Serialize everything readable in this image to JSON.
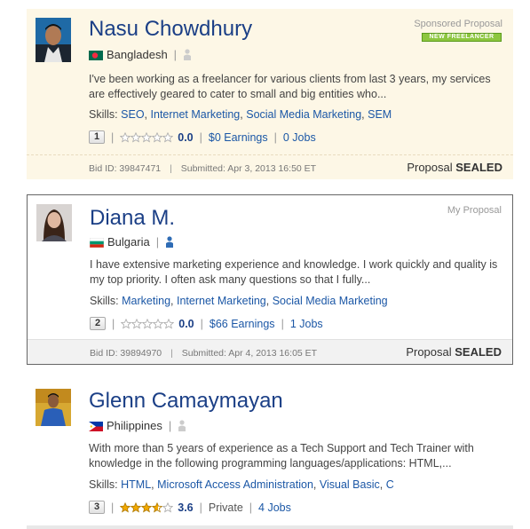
{
  "proposals": [
    {
      "name": "Nasu Chowdhury",
      "tag": "Sponsored Proposal",
      "badge": "NEW FREELANCER",
      "country": "Bangladesh",
      "description": "I've been working as a freelancer for various clients from last 3 years, my services are effectively geared to cater to small and big entities who...",
      "skills_label": "Skills:",
      "skills": [
        "SEO",
        "Internet Marketing",
        "Social Media Marketing",
        "SEM"
      ],
      "rank": "1",
      "rating": "0.0",
      "earnings": "$0 Earnings",
      "jobs": "0 Jobs",
      "bid_id": "Bid ID: 39847471",
      "submitted": "Submitted: Apr 3, 2013 16:50 ET",
      "proposal_label": "Proposal",
      "status": "SEALED"
    },
    {
      "name": "Diana M.",
      "tag": "My Proposal",
      "country": "Bulgaria",
      "description": "I have extensive marketing experience and knowledge. I work quickly and quality is my top priority. I often ask many questions so that I fully...",
      "skills_label": "Skills:",
      "skills": [
        "Marketing",
        "Internet Marketing",
        "Social Media Marketing"
      ],
      "rank": "2",
      "rating": "0.0",
      "earnings": "$66 Earnings",
      "jobs": "1 Jobs",
      "bid_id": "Bid ID: 39894970",
      "submitted": "Submitted: Apr 4, 2013 16:05 ET",
      "proposal_label": "Proposal",
      "status": "SEALED"
    },
    {
      "name": "Glenn Camaymayan",
      "country": "Philippines",
      "description": "With more than 5 years of experience as a Tech Support and Tech Trainer with knowledge in the following programming languages/applications: HTML,...",
      "skills_label": "Skills:",
      "skills": [
        "HTML",
        "Microsoft Access Administration",
        "Visual Basic",
        "C"
      ],
      "rank": "3",
      "rating": "3.6",
      "stars_filled": 3.6,
      "earnings": "Private",
      "jobs": "4 Jobs"
    }
  ],
  "separators": {
    "pipe": "|",
    "comma": ","
  },
  "colors": {
    "name": "#1b3f86",
    "link": "#1b57a6",
    "sponsored_bg": "#fdf7e6",
    "badge": "#8dc63f",
    "star": "#f2a900"
  }
}
